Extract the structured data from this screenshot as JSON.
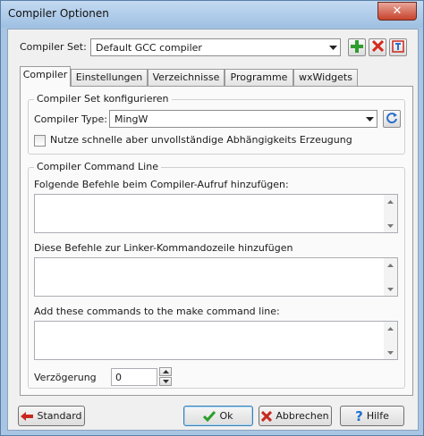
{
  "window": {
    "title": "Compiler Optionen",
    "close_glyph": "✕"
  },
  "compiler_set": {
    "label": "Compiler Set:",
    "value": "Default GCC compiler"
  },
  "tabs": [
    "Compiler",
    "Einstellungen",
    "Verzeichnisse",
    "Programme",
    "wxWidgets"
  ],
  "configure_group": {
    "title": "Compiler Set konfigurieren",
    "type_label": "Compiler Type:",
    "type_value": "MingW",
    "fast_dep_label": "Nutze schnelle aber unvollständige Abhängigkeits Erzeugung",
    "fast_dep_checked": false
  },
  "command_group": {
    "title": "Compiler Command Line",
    "compiler_cmds_label": "Folgende Befehle beim Compiler-Aufruf hinzufügen:",
    "compiler_cmds_value": "",
    "linker_cmds_label": "Diese Befehle zur Linker-Kommandozeile hinzufügen",
    "linker_cmds_value": "",
    "make_cmds_label": "Add these commands to the make command line:",
    "make_cmds_value": "",
    "delay_label": "Verzögerung",
    "delay_value": "0"
  },
  "buttons": {
    "default": "Standard",
    "ok": "Ok",
    "cancel": "Abbrechen",
    "help": "Hilfe"
  },
  "colors": {
    "add_icon": "#2e9e2e",
    "delete_icon": "#d32b1f",
    "rename_icon": "#2a6fc9",
    "check_icon": "#2b9e2b",
    "cancel_icon": "#c8281e",
    "help_icon": "#1f6fd1",
    "arrow_icon": "#c8281e"
  }
}
